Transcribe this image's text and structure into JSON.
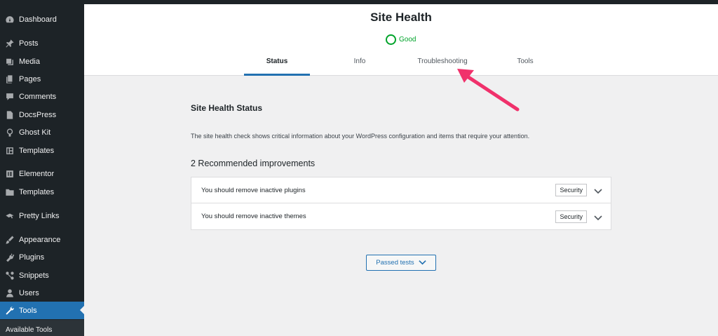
{
  "sidebar": {
    "items": [
      {
        "label": "Dashboard",
        "icon": "dashboard-icon"
      },
      {
        "label": "Posts",
        "icon": "pin-icon"
      },
      {
        "label": "Media",
        "icon": "media-icon"
      },
      {
        "label": "Pages",
        "icon": "pages-icon"
      },
      {
        "label": "Comments",
        "icon": "comment-icon"
      },
      {
        "label": "DocsPress",
        "icon": "document-icon"
      },
      {
        "label": "Ghost Kit",
        "icon": "ghost-icon"
      },
      {
        "label": "Templates",
        "icon": "layout-icon"
      },
      {
        "label": "Elementor",
        "icon": "elementor-icon"
      },
      {
        "label": "Templates",
        "icon": "folder-icon"
      },
      {
        "label": "Pretty Links",
        "icon": "link-icon"
      },
      {
        "label": "Appearance",
        "icon": "brush-icon"
      },
      {
        "label": "Plugins",
        "icon": "plugin-icon"
      },
      {
        "label": "Snippets",
        "icon": "snippets-icon"
      },
      {
        "label": "Users",
        "icon": "user-icon"
      },
      {
        "label": "Tools",
        "icon": "wrench-icon",
        "active": true
      }
    ],
    "submenu_label": "Available Tools"
  },
  "header": {
    "title": "Site Health",
    "status": "Good",
    "tabs": [
      {
        "label": "Status",
        "active": true
      },
      {
        "label": "Info"
      },
      {
        "label": "Troubleshooting"
      },
      {
        "label": "Tools"
      }
    ]
  },
  "main": {
    "section_title": "Site Health Status",
    "description": "The site health check shows critical information about your WordPress configuration and items that require your attention.",
    "improvements_heading": "2 Recommended improvements",
    "issues": [
      {
        "label": "You should remove inactive plugins",
        "badge": "Security"
      },
      {
        "label": "You should remove inactive themes",
        "badge": "Security"
      }
    ],
    "passed_tests_label": "Passed tests"
  },
  "colors": {
    "accent": "#2271b1",
    "good": "#00a32a",
    "sidebar_bg": "#1d2327",
    "annotation_arrow": "#f0316b"
  }
}
